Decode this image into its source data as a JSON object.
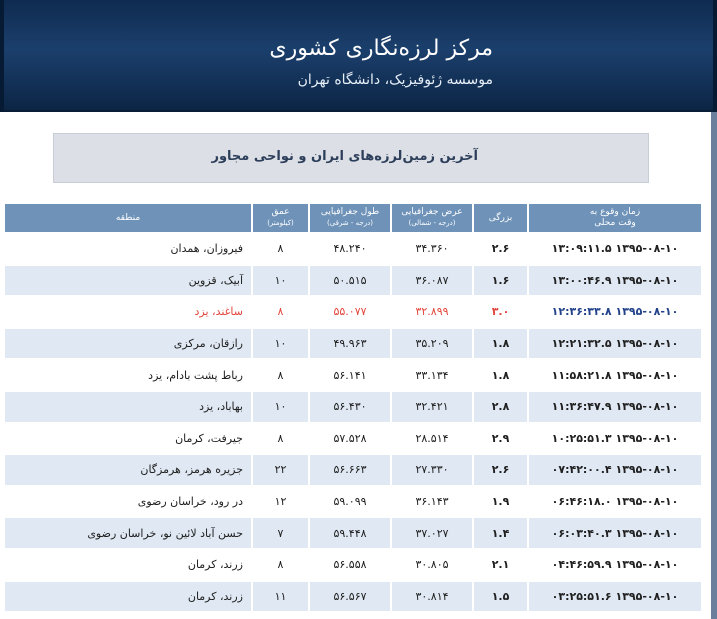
{
  "header": {
    "title": "مرکز لرزه‌نگاری کشوری",
    "subtitle": "موسسه ژئوفیزیک، دانشگاه تهران"
  },
  "banner": {
    "text": "آخرین زمین‌لرزه‌های ایران و نواحی مجاور"
  },
  "table": {
    "headers": {
      "time": [
        "زمان وقوع به",
        "وقت محلی"
      ],
      "magnitude": "بزرگی",
      "latitude": [
        "عرض جغرافیایی",
        "(درجه - شمالی)"
      ],
      "longitude": [
        "طول جغرافیایی",
        "(درجه - شرقی)"
      ],
      "depth": [
        "عمق",
        "(کیلومتر)"
      ],
      "region": "منطقه"
    },
    "rows": [
      {
        "time": "۱۳۹۵-۰۸-۱۰ ۱۳:۰۹:۱۱.۵",
        "mag": "۲.۶",
        "lat": "۳۴.۳۶۰",
        "lon": "۴۸.۲۴۰",
        "depth": "۸",
        "region": "فیروزان، همدان"
      },
      {
        "time": "۱۳۹۵-۰۸-۱۰ ۱۳:۰۰:۴۶.۹",
        "mag": "۱.۶",
        "lat": "۳۶.۰۸۷",
        "lon": "۵۰.۵۱۵",
        "depth": "۱۰",
        "region": "آبیک، قزوین"
      },
      {
        "time": "۱۳۹۵-۰۸-۱۰ ۱۲:۳۶:۳۳.۸",
        "mag": "۳.۰",
        "lat": "۳۲.۸۹۹",
        "lon": "۵۵.۰۷۷",
        "depth": "۸",
        "region": "ساغند، یزد"
      },
      {
        "time": "۱۳۹۵-۰۸-۱۰ ۱۲:۲۱:۳۲.۵",
        "mag": "۱.۸",
        "lat": "۳۵.۲۰۹",
        "lon": "۴۹.۹۶۳",
        "depth": "۱۰",
        "region": "رازقان، مرکزی"
      },
      {
        "time": "۱۳۹۵-۰۸-۱۰ ۱۱:۵۸:۲۱.۸",
        "mag": "۱.۸",
        "lat": "۳۳.۱۳۴",
        "lon": "۵۶.۱۴۱",
        "depth": "۸",
        "region": "رباط پشت بادام، یزد"
      },
      {
        "time": "۱۳۹۵-۰۸-۱۰ ۱۱:۳۶:۴۷.۹",
        "mag": "۲.۸",
        "lat": "۳۲.۴۲۱",
        "lon": "۵۶.۴۳۰",
        "depth": "۱۰",
        "region": "بهاباد، یزد"
      },
      {
        "time": "۱۳۹۵-۰۸-۱۰ ۱۰:۲۵:۵۱.۳",
        "mag": "۲.۹",
        "lat": "۲۸.۵۱۴",
        "lon": "۵۷.۵۲۸",
        "depth": "۸",
        "region": "جیرفت، کرمان"
      },
      {
        "time": "۱۳۹۵-۰۸-۱۰ ۰۷:۴۲:۰۰.۴",
        "mag": "۲.۶",
        "lat": "۲۷.۳۳۰",
        "lon": "۵۶.۶۶۳",
        "depth": "۲۲",
        "region": "جزیره هرمز، هرمزگان"
      },
      {
        "time": "۱۳۹۵-۰۸-۱۰ ۰۶:۴۶:۱۸.۰",
        "mag": "۱.۹",
        "lat": "۳۶.۱۴۳",
        "lon": "۵۹.۰۹۹",
        "depth": "۱۲",
        "region": "در رود، خراسان رضوی"
      },
      {
        "time": "۱۳۹۵-۰۸-۱۰ ۰۶:۰۳:۴۰.۳",
        "mag": "۱.۴",
        "lat": "۳۷.۰۲۷",
        "lon": "۵۹.۴۴۸",
        "depth": "۷",
        "region": "حسن آباد لائین نو، خراسان رضوی"
      },
      {
        "time": "۱۳۹۵-۰۸-۱۰ ۰۴:۴۶:۵۹.۹",
        "mag": "۲.۱",
        "lat": "۳۰.۸۰۵",
        "lon": "۵۶.۵۵۸",
        "depth": "۸",
        "region": "زرند، کرمان"
      },
      {
        "time": "۱۳۹۵-۰۸-۱۰ ۰۳:۲۵:۵۱.۶",
        "mag": "۱.۵",
        "lat": "۳۰.۸۱۴",
        "lon": "۵۶.۵۶۷",
        "depth": "۱۱",
        "region": "زرند، کرمان"
      }
    ],
    "highlight_color": "#e2463c",
    "header_color": "#6e92b8",
    "alt_row_color": "#dfe8f3"
  }
}
